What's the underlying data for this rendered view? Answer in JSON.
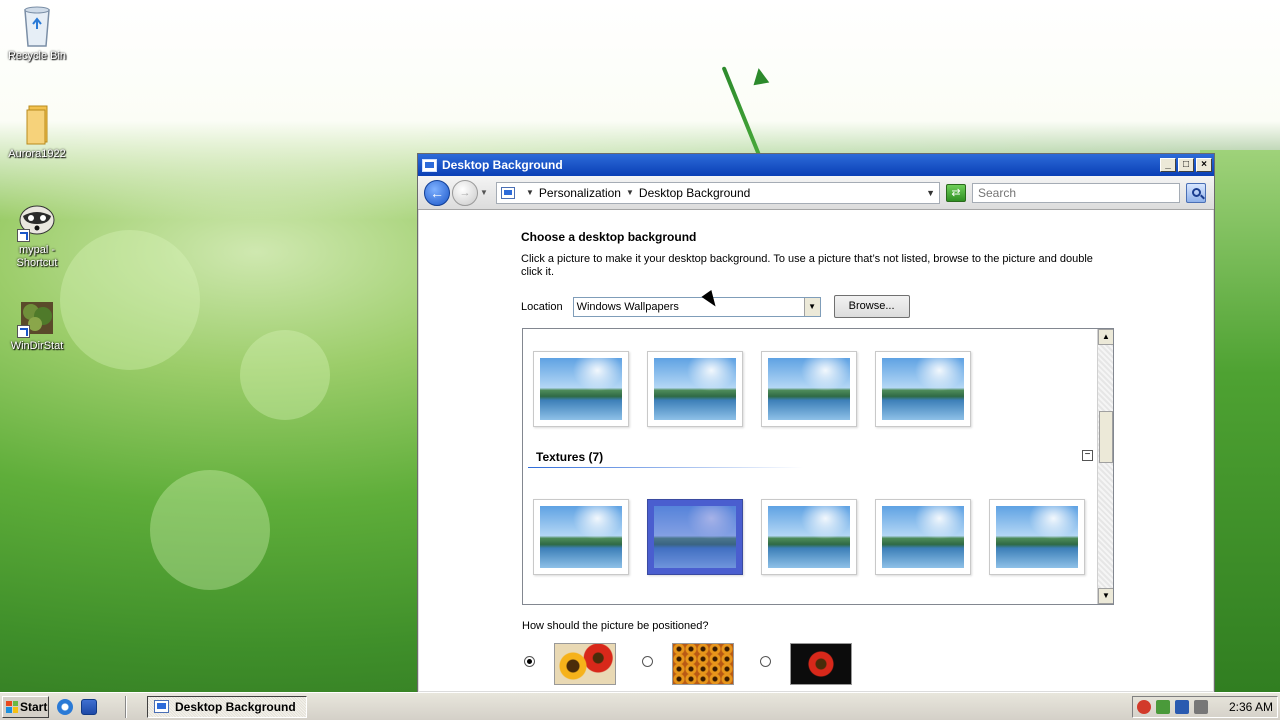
{
  "desktop": {
    "icons": [
      {
        "label": "Recycle Bin"
      },
      {
        "label": "Aurora1922"
      },
      {
        "label": "mypal - Shortcut"
      },
      {
        "label": "WinDirStat"
      }
    ]
  },
  "window": {
    "title": "Desktop Background",
    "buttons": {
      "minimize": "_",
      "maximize": "□",
      "close": "×"
    },
    "address": {
      "crumbs": [
        "Personalization",
        "Desktop Background"
      ],
      "search_placeholder": "Search"
    },
    "heading": "Choose a desktop background",
    "description": "Click a picture to make it your desktop background. To use a picture that’s not listed, browse to the picture and double click it.",
    "location_label": "Location",
    "location_value": "Windows Wallpapers",
    "browse_label": "Browse...",
    "section_title": "Textures (7)",
    "collapse_glyph": "−",
    "position_question": "How should the picture be positioned?"
  },
  "taskbar": {
    "start_label": "Start",
    "active_task": "Desktop Background",
    "clock": "2:36 AM"
  },
  "colors": {
    "title_bar": "#0a3fb5",
    "selection": "#4a5ecf"
  }
}
